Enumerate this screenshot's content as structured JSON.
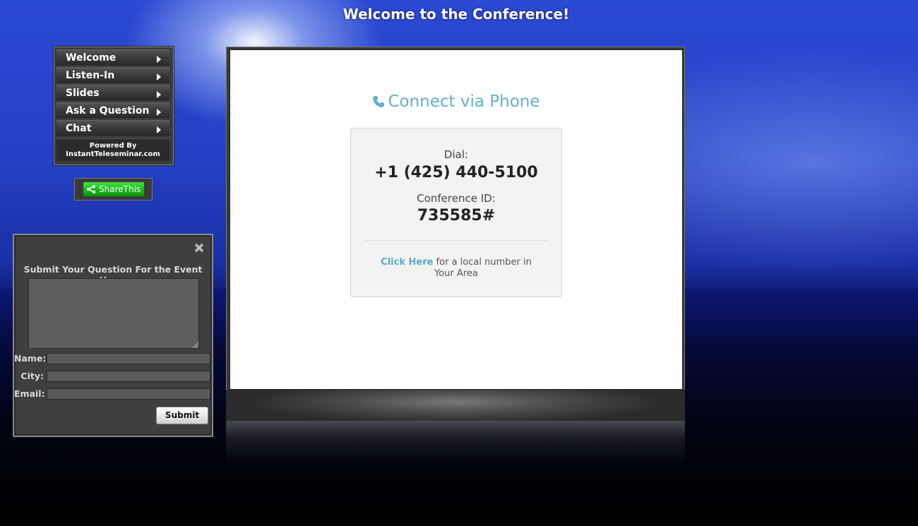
{
  "page": {
    "title": "Welcome to the Conference!"
  },
  "menu": {
    "items": [
      {
        "label": "Welcome"
      },
      {
        "label": "Listen-In"
      },
      {
        "label": "Slides"
      },
      {
        "label": "Ask a Question"
      },
      {
        "label": "Chat"
      }
    ],
    "powered_by_line1": "Powered By",
    "powered_by_line2": "InstantTeleseminar.com"
  },
  "share": {
    "label": "ShareThis",
    "color": "#18b418"
  },
  "question_form": {
    "heading": "Submit Your Question For the Event Here:",
    "name_label": "Name:",
    "city_label": "City:",
    "email_label": "Email:",
    "submit_label": "Submit",
    "question_value": "",
    "name_value": "",
    "city_value": "",
    "email_value": ""
  },
  "connect": {
    "title": "Connect via Phone",
    "dial_label": "Dial:",
    "dial_number": "+1 (425) 440-5100",
    "conference_id_label": "Conference ID:",
    "conference_id": "735585#",
    "click_here": "Click Here",
    "local_text": "for a local number in Your Area",
    "accent_color": "#62b0cb"
  },
  "icons": {
    "phone": "phone-icon",
    "share": "share-icon",
    "close": "close-icon",
    "menu_arrow": "chevron-right-icon"
  }
}
